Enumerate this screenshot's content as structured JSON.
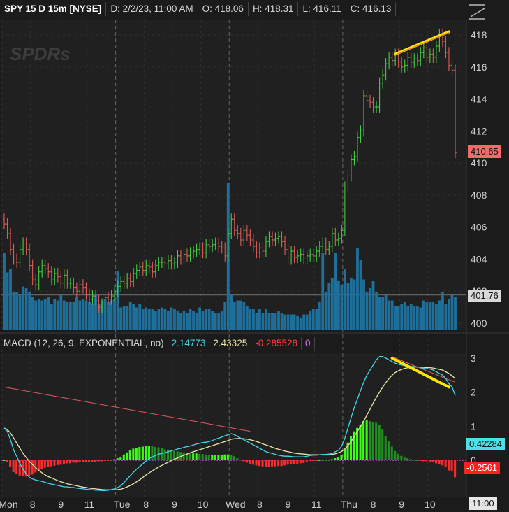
{
  "header": {
    "title": "SPY 15 D 15m [NYSE]",
    "date": "D: 2/2/23, 11:00 AM",
    "open": "O: 418.06",
    "high": "H: 418.31",
    "low": "L: 416.11",
    "close": "C: 416.13"
  },
  "watermark": "SPDRs",
  "price_badges": {
    "red": "410.65",
    "gray": "401.76"
  },
  "macd": {
    "label": "MACD (12, 26, 9, EXPONENTIAL, no)",
    "value": "2.14773",
    "avg": "2.43325",
    "diff": "-0.285528",
    "zero": "0",
    "badge_value": "0.42284",
    "badge_diff": "-0.2561"
  },
  "time_badge": "11:00",
  "colors": {
    "up": "#3ecf3e",
    "down": "#e05a5a",
    "volume": "#1e6f9a",
    "macd_value": "#40d8e8",
    "macd_avg": "#ece6a8",
    "diff_pos_strong": "#39ff14",
    "diff_pos_weak": "#1f8f1f",
    "diff_neg": "#ff2a2a",
    "trendline": "#ffe600"
  },
  "chart_data": [
    {
      "type": "candlestick",
      "title": "SPY 15 D 15m [NYSE]",
      "ylim": [
        399.5,
        419.6
      ],
      "y_ticks": [
        "418",
        "416",
        "414",
        "412",
        "410",
        "408",
        "406",
        "404",
        "402",
        "400"
      ],
      "x_ticks": [
        "Mon",
        "8",
        "9",
        "11",
        "Tue",
        "8",
        "9",
        "10",
        "Wed",
        "8",
        "9",
        "11",
        "Thu",
        "8",
        "9",
        "10"
      ],
      "bars_per_session": 36,
      "sessions": [
        "Mon",
        "Tue",
        "Wed",
        "Thu"
      ],
      "close": [
        406.2,
        405.6,
        404.6,
        404.0,
        403.8,
        404.6,
        405.0,
        404.6,
        403.6,
        402.7,
        402.4,
        403.2,
        403.6,
        403.4,
        403.2,
        402.7,
        403.1,
        402.9,
        402.5,
        403.0,
        402.5,
        402.5,
        402.2,
        402.0,
        402.4,
        402.2,
        401.8,
        401.5,
        401.7,
        401.4,
        401.0,
        401.2,
        401.6,
        401.5,
        401.7,
        402.0,
        402.3,
        402.6,
        402.5,
        402.8,
        402.6,
        403.1,
        403.3,
        403.5,
        403.3,
        403.6,
        403.5,
        403.2,
        403.6,
        403.8,
        403.8,
        403.7,
        403.9,
        403.7,
        403.8,
        404.2,
        404.0,
        404.3,
        404.2,
        404.4,
        404.5,
        404.6,
        404.7,
        404.4,
        404.9,
        404.8,
        404.9,
        405.0,
        404.8,
        404.7,
        404.2,
        405.6,
        406.5,
        405.8,
        405.6,
        405.2,
        405.8,
        405.5,
        405.2,
        404.8,
        404.4,
        404.7,
        404.5,
        405.1,
        405.4,
        405.2,
        405.3,
        405.4,
        405.1,
        404.6,
        404.0,
        404.5,
        404.1,
        404.2,
        404.3,
        404.0,
        404.2,
        404.3,
        404.2,
        404.5,
        404.8,
        405.0,
        404.6,
        404.8,
        405.6,
        405.2,
        405.3,
        405.8,
        408.5,
        409.2,
        410.2,
        410.4,
        411.6,
        412.0,
        414.2,
        413.9,
        413.8,
        413.5,
        413.5,
        415.0,
        415.5,
        416.2,
        416.6,
        416.4,
        416.8,
        416.3,
        416.0,
        416.1,
        416.6,
        416.3,
        416.5,
        416.4,
        416.9,
        417.2,
        416.6,
        416.8,
        416.6,
        417.3,
        418.0,
        417.6,
        416.9,
        416.1,
        415.8,
        410.65
      ],
      "volume_ylim": [
        0,
        100
      ],
      "volume": [
        44,
        33,
        35,
        22,
        22,
        20,
        25,
        24,
        22,
        19,
        17,
        18,
        17,
        18,
        19,
        15,
        18,
        17,
        20,
        17,
        16,
        16,
        16,
        19,
        17,
        18,
        17,
        16,
        15,
        20,
        15,
        17,
        18,
        16,
        17,
        18,
        34,
        13,
        14,
        14,
        16,
        15,
        13,
        15,
        12,
        13,
        12,
        12,
        11,
        12,
        13,
        12,
        11,
        13,
        12,
        11,
        10,
        11,
        10,
        12,
        11,
        10,
        13,
        11,
        12,
        12,
        11,
        10,
        10,
        11,
        16,
        84,
        20,
        16,
        17,
        17,
        16,
        14,
        12,
        12,
        10,
        12,
        10,
        12,
        10,
        10,
        10,
        11,
        10,
        9,
        9,
        9,
        9,
        8,
        7,
        9,
        9,
        11,
        12,
        12,
        16,
        44,
        22,
        27,
        30,
        44,
        28,
        26,
        35,
        27,
        30,
        29,
        47,
        40,
        29,
        22,
        24,
        28,
        22,
        19,
        19,
        20,
        17,
        17,
        14,
        14,
        15,
        16,
        14,
        15,
        14,
        14,
        13,
        17,
        16,
        16,
        16,
        15,
        17,
        22,
        15,
        18,
        20,
        19
      ],
      "trendline": {
        "from_index": 124,
        "from_value": 416.8,
        "to_index": 141,
        "to_value": 418.2
      }
    },
    {
      "type": "line",
      "title": "MACD (12, 26, 9, EXPONENTIAL, no)",
      "ylim": [
        -1.05,
        3.05
      ],
      "y_ticks": [
        "3",
        "2",
        "1",
        "0"
      ],
      "series": [
        {
          "name": "Value",
          "values": [
            0.95,
            0.85,
            0.6,
            0.3,
            0.1,
            -0.1,
            -0.27,
            -0.4,
            -0.5,
            -0.55,
            -0.58,
            -0.6,
            -0.62,
            -0.65,
            -0.68,
            -0.7,
            -0.72,
            -0.74,
            -0.76,
            -0.78,
            -0.78,
            -0.8,
            -0.8,
            -0.82,
            -0.83,
            -0.84,
            -0.85,
            -0.86,
            -0.87,
            -0.88,
            -0.88,
            -0.89,
            -0.89,
            -0.88,
            -0.86,
            -0.84,
            -0.8,
            -0.75,
            -0.65,
            -0.55,
            -0.45,
            -0.35,
            -0.26,
            -0.18,
            -0.1,
            -0.02,
            0.05,
            0.1,
            0.14,
            0.18,
            0.2,
            0.22,
            0.25,
            0.28,
            0.3,
            0.33,
            0.35,
            0.38,
            0.4,
            0.42,
            0.45,
            0.48,
            0.5,
            0.52,
            0.53,
            0.55,
            0.58,
            0.62,
            0.65,
            0.68,
            0.72,
            0.75,
            0.78,
            0.75,
            0.7,
            0.65,
            0.6,
            0.55,
            0.5,
            0.45,
            0.4,
            0.35,
            0.3,
            0.25,
            0.22,
            0.2,
            0.17,
            0.15,
            0.13,
            0.12,
            0.12,
            0.11,
            0.1,
            0.1,
            0.1,
            0.1,
            0.12,
            0.14,
            0.15,
            0.15,
            0.16,
            0.17,
            0.17,
            0.18,
            0.2,
            0.25,
            0.3,
            0.42,
            0.65,
            0.95,
            1.25,
            1.55,
            1.8,
            2.05,
            2.3,
            2.5,
            2.65,
            2.8,
            2.95,
            3.05,
            3.05,
            3.0,
            2.95,
            2.9,
            2.85,
            2.82,
            2.8,
            2.78,
            2.78,
            2.76,
            2.75,
            2.74,
            2.72,
            2.7,
            2.69,
            2.68,
            2.65,
            2.6,
            2.55,
            2.5,
            2.4,
            2.25,
            2.15,
            1.9
          ]
        },
        {
          "name": "Avg",
          "values": [
            0.95,
            0.9,
            0.8,
            0.65,
            0.5,
            0.35,
            0.2,
            0.08,
            -0.03,
            -0.13,
            -0.22,
            -0.3,
            -0.37,
            -0.43,
            -0.48,
            -0.52,
            -0.56,
            -0.6,
            -0.63,
            -0.66,
            -0.69,
            -0.71,
            -0.73,
            -0.75,
            -0.77,
            -0.79,
            -0.8,
            -0.82,
            -0.83,
            -0.84,
            -0.85,
            -0.86,
            -0.87,
            -0.87,
            -0.87,
            -0.87,
            -0.86,
            -0.85,
            -0.82,
            -0.78,
            -0.74,
            -0.69,
            -0.63,
            -0.57,
            -0.5,
            -0.43,
            -0.37,
            -0.31,
            -0.25,
            -0.2,
            -0.15,
            -0.1,
            -0.06,
            -0.01,
            0.03,
            0.07,
            0.11,
            0.15,
            0.18,
            0.22,
            0.25,
            0.28,
            0.31,
            0.34,
            0.37,
            0.4,
            0.43,
            0.46,
            0.49,
            0.52,
            0.55,
            0.58,
            0.62,
            0.63,
            0.64,
            0.64,
            0.63,
            0.62,
            0.6,
            0.58,
            0.55,
            0.52,
            0.48,
            0.45,
            0.42,
            0.38,
            0.35,
            0.32,
            0.3,
            0.27,
            0.25,
            0.23,
            0.21,
            0.2,
            0.19,
            0.18,
            0.17,
            0.16,
            0.16,
            0.16,
            0.16,
            0.16,
            0.16,
            0.16,
            0.17,
            0.19,
            0.22,
            0.26,
            0.33,
            0.43,
            0.55,
            0.7,
            0.85,
            1.0,
            1.15,
            1.33,
            1.5,
            1.68,
            1.85,
            2.0,
            2.15,
            2.28,
            2.4,
            2.5,
            2.58,
            2.63,
            2.67,
            2.7,
            2.72,
            2.73,
            2.74,
            2.74,
            2.74,
            2.73,
            2.72,
            2.72,
            2.71,
            2.69,
            2.67,
            2.65,
            2.6,
            2.55,
            2.48,
            2.4
          ]
        },
        {
          "name": "Diff",
          "type": "histogram",
          "values": [
            0,
            -0.05,
            -0.2,
            -0.35,
            -0.4,
            -0.45,
            -0.47,
            -0.48,
            -0.47,
            -0.42,
            -0.36,
            -0.3,
            -0.25,
            -0.22,
            -0.2,
            -0.18,
            -0.16,
            -0.14,
            -0.13,
            -0.12,
            -0.09,
            -0.09,
            -0.07,
            -0.07,
            -0.06,
            -0.05,
            -0.05,
            -0.04,
            -0.04,
            -0.04,
            -0.03,
            -0.03,
            -0.02,
            -0.01,
            0.01,
            0.03,
            0.06,
            0.1,
            0.17,
            0.23,
            0.29,
            0.34,
            0.37,
            0.39,
            0.4,
            0.41,
            0.42,
            0.41,
            0.39,
            0.38,
            0.35,
            0.32,
            0.31,
            0.29,
            0.27,
            0.26,
            0.24,
            0.23,
            0.22,
            0.2,
            0.2,
            0.2,
            0.19,
            0.18,
            0.16,
            0.15,
            0.15,
            0.16,
            0.16,
            0.16,
            0.17,
            0.17,
            0.16,
            0.12,
            0.06,
            0.01,
            -0.03,
            -0.07,
            -0.1,
            -0.13,
            -0.15,
            -0.17,
            -0.18,
            -0.2,
            -0.2,
            -0.18,
            -0.18,
            -0.17,
            -0.17,
            -0.15,
            -0.13,
            -0.12,
            -0.11,
            -0.1,
            -0.09,
            -0.08,
            -0.05,
            -0.02,
            -0.01,
            -0.01,
            0.0,
            0.01,
            0.01,
            0.02,
            0.03,
            0.06,
            0.08,
            0.16,
            0.32,
            0.52,
            0.7,
            0.85,
            0.95,
            1.05,
            1.15,
            1.17,
            1.15,
            1.12,
            1.1,
            1.05,
            0.9,
            0.72,
            0.55,
            0.4,
            0.27,
            0.19,
            0.13,
            0.08,
            0.06,
            0.03,
            0.01,
            0.0,
            -0.02,
            -0.03,
            -0.03,
            -0.04,
            -0.06,
            -0.09,
            -0.12,
            -0.15,
            -0.2,
            -0.3,
            -0.33,
            -0.5
          ]
        }
      ],
      "divergence_line": {
        "from_index": 0,
        "from_value": 2.15,
        "to_index": 78,
        "to_value": 0.85
      },
      "trendline": {
        "from_index": 123,
        "from_value": 3.0,
        "to_index": 141,
        "to_value": 2.15
      }
    }
  ]
}
